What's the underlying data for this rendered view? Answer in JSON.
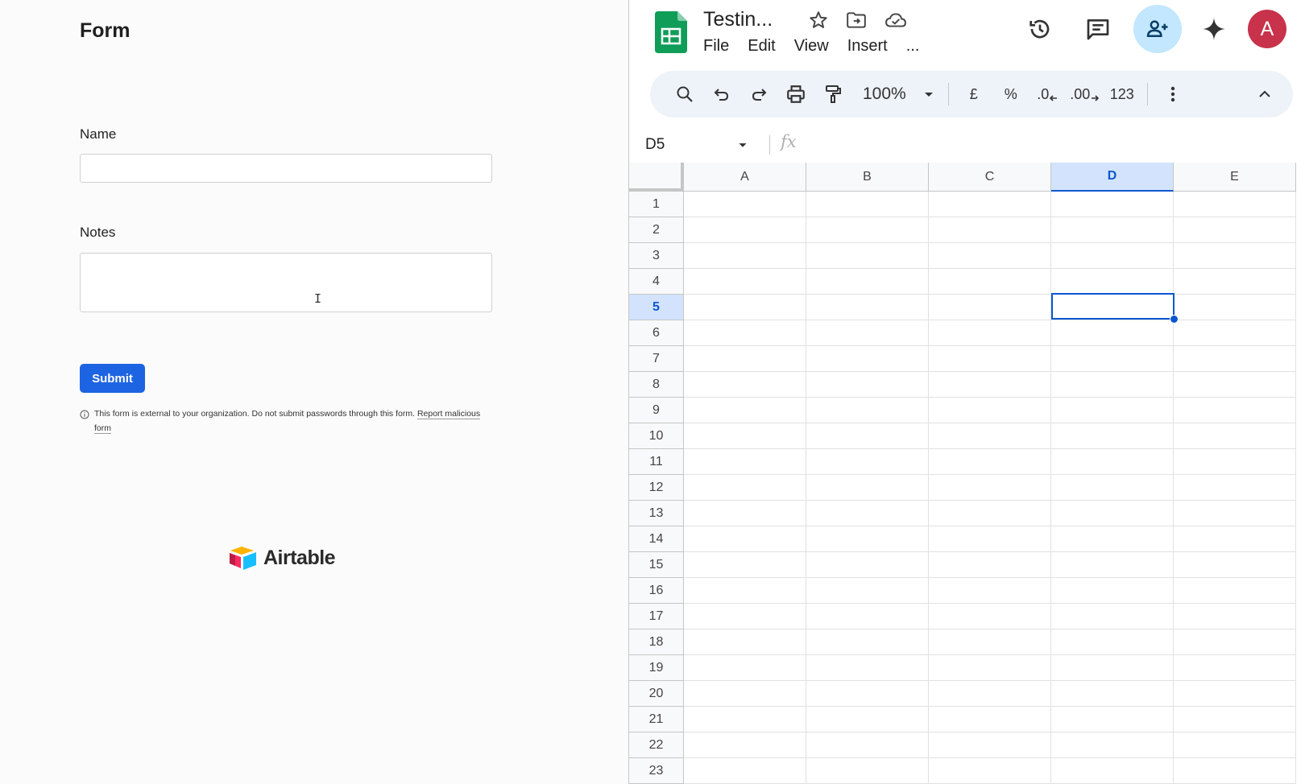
{
  "form": {
    "title": "Form",
    "name_label": "Name",
    "name_value": "",
    "notes_label": "Notes",
    "notes_value": "",
    "submit_label": "Submit",
    "disclaimer_text": "This form is external to your organization. Do not submit passwords through this form.",
    "report_link": "Report malicious form",
    "brand_name": "Airtable",
    "brand_colors": {
      "yellow": "#FCB400",
      "blue": "#18BFFF",
      "red": "#F82B60",
      "dark_red": "#BA1E45"
    }
  },
  "sheets": {
    "doc_title": "Testin...",
    "menu": [
      "File",
      "Edit",
      "View",
      "Insert",
      "..."
    ],
    "avatar_letter": "A",
    "avatar_color": "#C8324B",
    "toolbar": {
      "zoom": "100%",
      "currency": "£",
      "percent": "%",
      "decrease_decimal": ".0",
      "increase_decimal": ".00",
      "number_format": "123"
    },
    "name_box": "D5",
    "fx_label": "fx",
    "columns": [
      "A",
      "B",
      "C",
      "D",
      "E"
    ],
    "rows": [
      1,
      2,
      3,
      4,
      5,
      6,
      7,
      8,
      9,
      10,
      11,
      12,
      13,
      14,
      15,
      16,
      17,
      18,
      19,
      20,
      21,
      22,
      23
    ],
    "active_column": "D",
    "active_row": 5,
    "accent_color": "#0B57D0"
  }
}
